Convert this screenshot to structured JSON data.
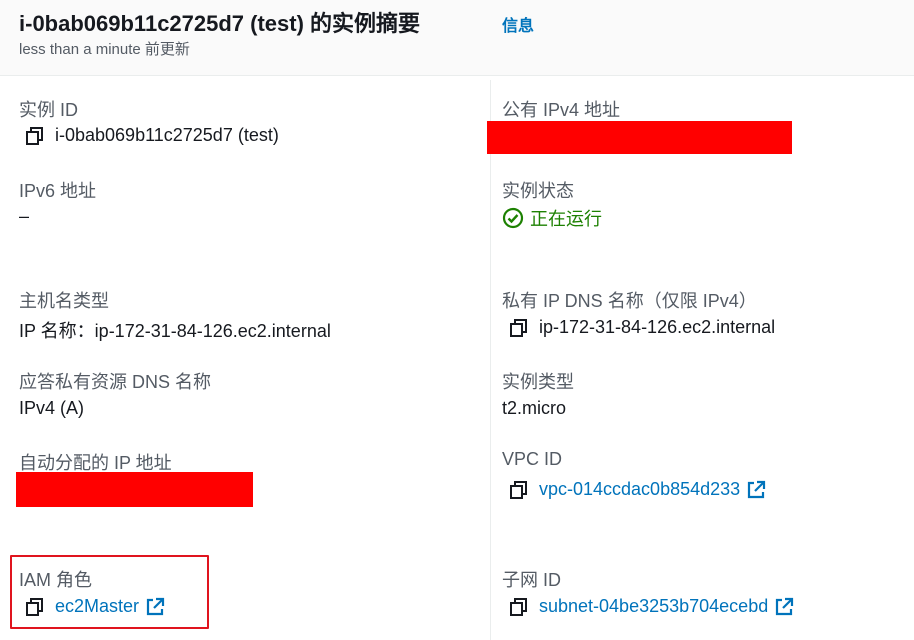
{
  "header": {
    "title": "i-0bab069b11c2725d7 (test) 的实例摘要",
    "info_link": "信息",
    "updated": "less than a minute 前更新"
  },
  "left": {
    "instance_id": {
      "label": "实例 ID",
      "value": "i-0bab069b11c2725d7 (test)"
    },
    "ipv6": {
      "label": "IPv6 地址",
      "value": "–"
    },
    "hostname_type": {
      "label": "主机名类型",
      "value": "IP 名称：ip-172-31-84-126.ec2.internal"
    },
    "answer_dns": {
      "label": "应答私有资源 DNS 名称",
      "value": "IPv4 (A)"
    },
    "auto_ip": {
      "label": "自动分配的 IP 地址"
    },
    "iam_role": {
      "label": "IAM 角色",
      "value": "ec2Master"
    }
  },
  "right": {
    "public_ipv4": {
      "label": "公有 IPv4 地址"
    },
    "instance_state": {
      "label": "实例状态",
      "value": "正在运行"
    },
    "private_dns": {
      "label": "私有 IP DNS 名称（仅限 IPv4）",
      "value": "ip-172-31-84-126.ec2.internal"
    },
    "instance_type": {
      "label": "实例类型",
      "value": "t2.micro"
    },
    "vpc_id": {
      "label": "VPC ID",
      "value": "vpc-014ccdac0b854d233"
    },
    "subnet_id": {
      "label": "子网 ID",
      "value": "subnet-04be3253b704ecebd"
    }
  },
  "icons": {
    "copy": "copy-icon",
    "external_link": "external-link-icon",
    "status_check": "check-circle-icon"
  },
  "colors": {
    "link": "#0073bb",
    "running": "#1d8102",
    "redaction": "#ff0000",
    "highlight": "#e0141e"
  }
}
